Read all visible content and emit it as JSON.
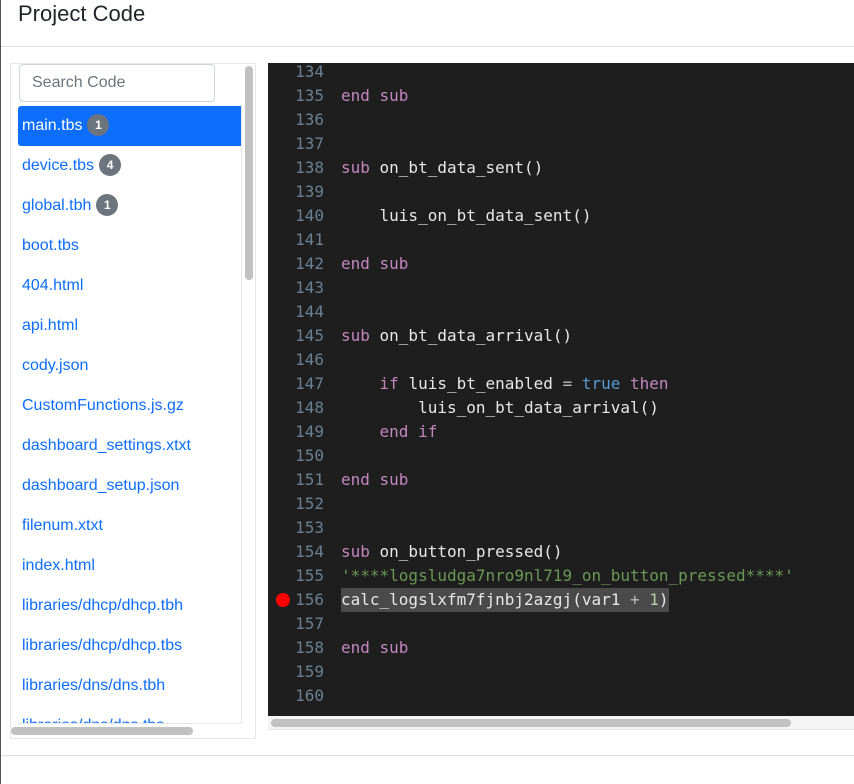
{
  "header": {
    "title": "Project Code"
  },
  "sidebar": {
    "search_placeholder": "Search Code",
    "files": [
      {
        "name": "main.tbs",
        "badge": "1",
        "active": true
      },
      {
        "name": "device.tbs",
        "badge": "4"
      },
      {
        "name": "global.tbh",
        "badge": "1"
      },
      {
        "name": "boot.tbs"
      },
      {
        "name": "404.html"
      },
      {
        "name": "api.html"
      },
      {
        "name": "cody.json"
      },
      {
        "name": "CustomFunctions.js.gz"
      },
      {
        "name": "dashboard_settings.xtxt"
      },
      {
        "name": "dashboard_setup.json"
      },
      {
        "name": "filenum.xtxt"
      },
      {
        "name": "index.html"
      },
      {
        "name": "libraries/dhcp/dhcp.tbh"
      },
      {
        "name": "libraries/dhcp/dhcp.tbs"
      },
      {
        "name": "libraries/dns/dns.tbh"
      },
      {
        "name": "libraries/dns/dns.tbs"
      }
    ]
  },
  "editor": {
    "breakpoint_color": "#ff0000",
    "lines": [
      {
        "n": "134",
        "t": []
      },
      {
        "n": "135",
        "t": [
          [
            "kw",
            "end sub"
          ]
        ]
      },
      {
        "n": "136",
        "t": []
      },
      {
        "n": "137",
        "t": []
      },
      {
        "n": "138",
        "t": [
          [
            "kw",
            "sub "
          ],
          [
            "id",
            "on_bt_data_sent()"
          ]
        ]
      },
      {
        "n": "139",
        "t": []
      },
      {
        "n": "140",
        "t": [
          [
            "id",
            "    luis_on_bt_data_sent()"
          ]
        ]
      },
      {
        "n": "141",
        "t": []
      },
      {
        "n": "142",
        "t": [
          [
            "kw",
            "end sub"
          ]
        ]
      },
      {
        "n": "143",
        "t": []
      },
      {
        "n": "144",
        "t": []
      },
      {
        "n": "145",
        "t": [
          [
            "kw",
            "sub "
          ],
          [
            "id",
            "on_bt_data_arrival()"
          ]
        ]
      },
      {
        "n": "146",
        "t": []
      },
      {
        "n": "147",
        "t": [
          [
            "kw",
            "    if "
          ],
          [
            "id",
            "luis_bt_enabled "
          ],
          [
            "op",
            "= "
          ],
          [
            "const",
            "true "
          ],
          [
            "kw",
            "then"
          ]
        ]
      },
      {
        "n": "148",
        "t": [
          [
            "id",
            "        luis_on_bt_data_arrival()"
          ]
        ]
      },
      {
        "n": "149",
        "t": [
          [
            "kw",
            "    end if"
          ]
        ]
      },
      {
        "n": "150",
        "t": []
      },
      {
        "n": "151",
        "t": [
          [
            "kw",
            "end sub"
          ]
        ]
      },
      {
        "n": "152",
        "t": []
      },
      {
        "n": "153",
        "t": []
      },
      {
        "n": "154",
        "t": [
          [
            "kw",
            "sub "
          ],
          [
            "id",
            "on_button_pressed()"
          ]
        ]
      },
      {
        "n": "155",
        "t": [
          [
            "cm",
            "'****logsludga7nro9nl719_on_button_pressed****'"
          ]
        ]
      },
      {
        "n": "156",
        "t": [
          [
            "id",
            "calc_logslxfm7fjnbj2azgj(var1 "
          ],
          [
            "op",
            "+ "
          ],
          [
            "num",
            "1"
          ],
          [
            "id",
            ")"
          ]
        ],
        "breakpoint": true,
        "highlight": true
      },
      {
        "n": "157",
        "t": []
      },
      {
        "n": "158",
        "t": [
          [
            "kw",
            "end sub"
          ]
        ]
      },
      {
        "n": "159",
        "t": []
      },
      {
        "n": "160",
        "t": []
      }
    ]
  }
}
